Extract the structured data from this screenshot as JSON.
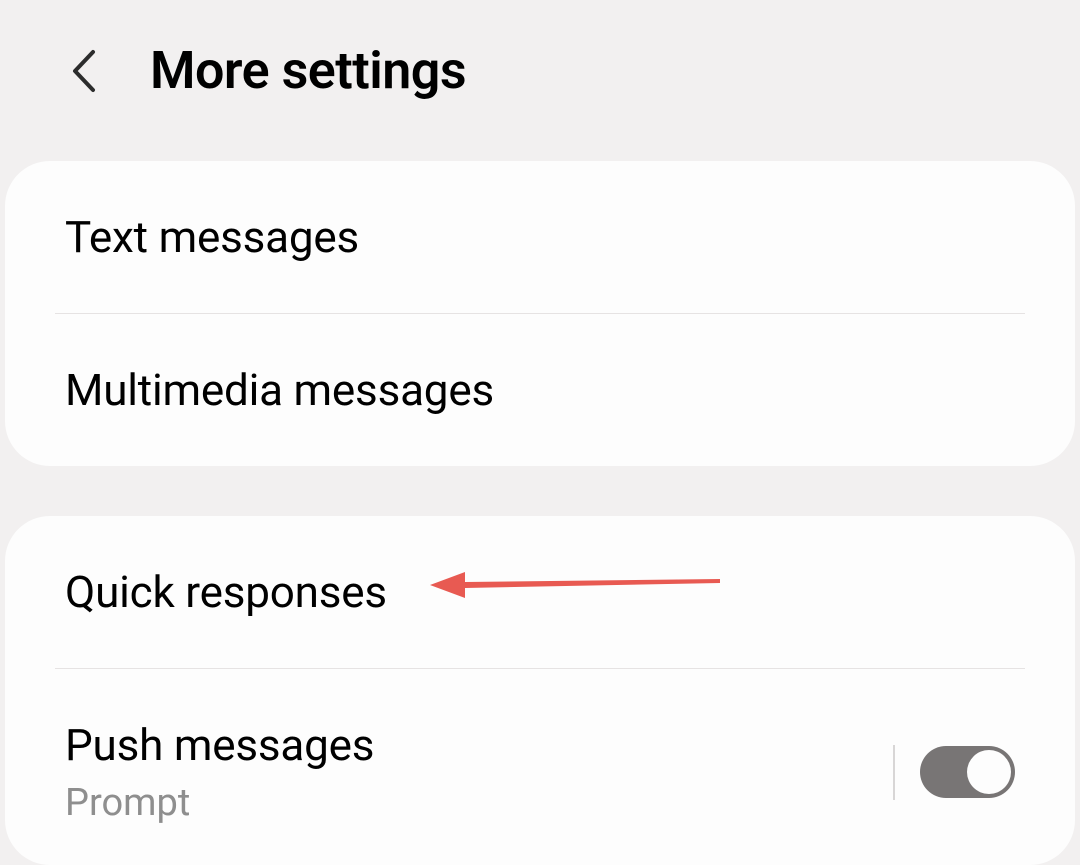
{
  "header": {
    "title": "More settings"
  },
  "card1": {
    "items": [
      {
        "label": "Text messages"
      },
      {
        "label": "Multimedia messages"
      }
    ]
  },
  "card2": {
    "items": [
      {
        "label": "Quick responses"
      },
      {
        "label": "Push messages",
        "sublabel": "Prompt",
        "toggle": true
      }
    ]
  }
}
